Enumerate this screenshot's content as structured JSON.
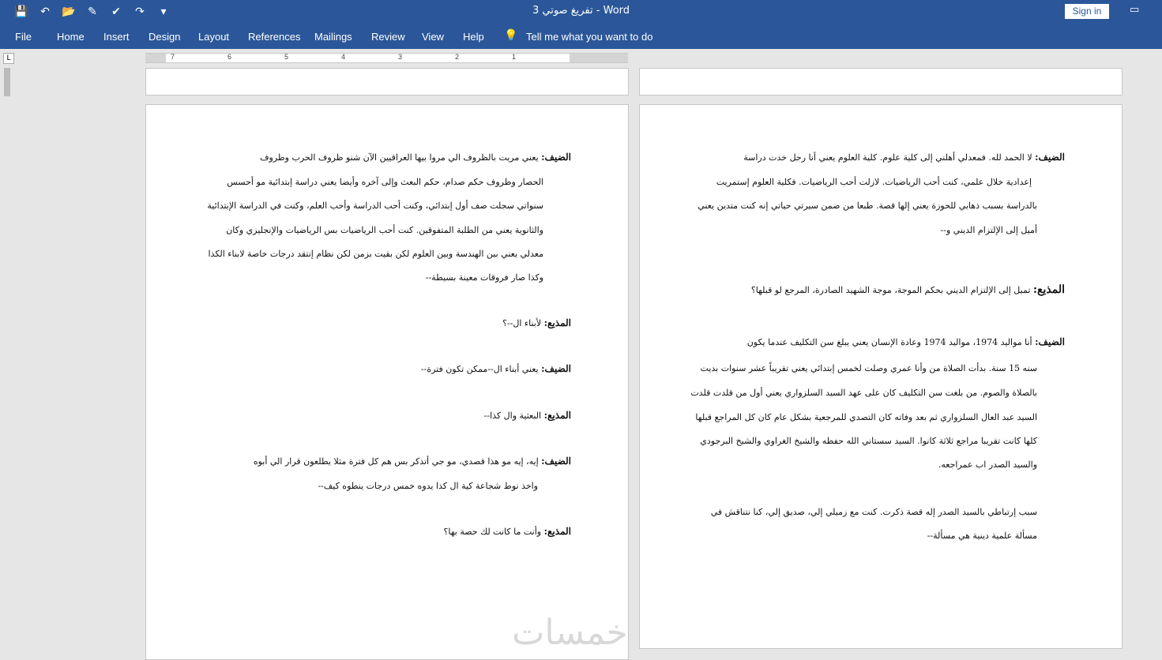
{
  "window": {
    "title": "تفريغ صوتي 3  -  Word",
    "signin": "Sign in"
  },
  "qat_icons": [
    "save-icon",
    "undo-icon",
    "open-icon",
    "format-painter-icon",
    "check-icon",
    "redo-icon",
    "customize-icon"
  ],
  "qat_glyphs": [
    "💾",
    "↶",
    "📂",
    "✎",
    "✔",
    "↷",
    "▾"
  ],
  "ribbon": {
    "tabs": [
      "File",
      "Home",
      "Insert",
      "Design",
      "Layout",
      "References",
      "Mailings",
      "Review",
      "View",
      "Help"
    ],
    "tell_me": "Tell me what you want to do",
    "bulb": "💡"
  },
  "ruler": {
    "numbers": [
      "7",
      "6",
      "5",
      "4",
      "3",
      "2",
      "1"
    ]
  },
  "left_page": {
    "lines": [
      {
        "speaker": "الضيف:",
        "text": "يعني مريت بالظروف الي مروا بيها العراقيين الآن شنو ظروف الحرب وظروف"
      },
      {
        "text": "الحصار وظروف حكم صدام، حكم البعث وإلى آخره وأيضا يعني دراسة إبتدائية مو أحسس"
      },
      {
        "text": "سنواتي سجلت صف أول إبتدائي، وكنت أحب الدراسة وأحب العلم، وكنت في الدراسة الإبتدائية"
      },
      {
        "text": "والثانوية يعني من الطلبة المتفوقين. كنت أحب الرياضيات بس الرياضيات والإنجليزي وكان"
      },
      {
        "text": "معدلي يعني بين الهندسة وبين العلوم لكن بقيت بزمن لكن نظام إنتقد درجات خاصة لابناء الكذا"
      },
      {
        "text": "وكذا صار فروقات معينة بسيطة--"
      },
      {
        "speaker": "المذيع:",
        "text": "لأبناء ال--؟"
      },
      {
        "speaker": "الضيف:",
        "text": "يعني أبناء ال--ممكن تكون فترة--"
      },
      {
        "speaker": "المذيع:",
        "text": "البعثية وال كذا--"
      },
      {
        "speaker": "الضيف:",
        "text": "إيه، إيه مو هذا قصدي، مو جي أتذكر بس هم كل فترة مثلا يطلعون قرار الي أبوه"
      },
      {
        "text": "واخذ نوط شجاعة كية ال كذا يدوه خمس درجات ينطوه كيف--"
      },
      {
        "speaker": "المذيع:",
        "text": "وأنت ما كانت لك حصة بها؟"
      }
    ]
  },
  "right_page": {
    "lines": [
      {
        "speaker": "الضيف:",
        "text": "لا الحمد لله. فمعدلي أهلني إلى كلية علوم. كلية العلوم يعني أنا رجل خدت دراسة"
      },
      {
        "text": "إعدادية خلال علمي، كنت أحب الرياضيات. لازلت أحب الرياضيات. فكلية العلوم إستمريت"
      },
      {
        "text": "بالدراسة بسبب ذهابي للحوزة يعني إلها قصة. طبعا من ضمن سيرتي حياتي إنه كنت متدين يعني"
      },
      {
        "text": "أميل إلى الإلتزام الديني و--"
      },
      {
        "speaker": "المذيع:",
        "text": "تميل إلى الإلتزام الديني بحكم الموجة، موجة الشهيد الصادرة، المرجع لو قبلها؟"
      },
      {
        "speaker": "الضيف:",
        "text": "أنا مواليد 1974، مواليد 1974 وعادة الإنسان يعني يبلغ سن التكليف عندما يكون"
      },
      {
        "text": "سنه 15 سنة. بدأت الصلاة من وأنا عمري وصلت لخمس إبتدائي يعني تقريباً عشر سنوات بديت"
      },
      {
        "text": "بالصلاة والصوم. من بلغت سن التكليف كان على عهد السيد السلزواري يعني أول من قلدت قلدت"
      },
      {
        "text": "السيد عبد العال السلزواري ثم بعد وفاته كان التصدي للمرجعية بشكل عام كان كل المراجع قبلها"
      },
      {
        "text": "كلها كانت تقريبا مراجع ثلاثة كانوا. السيد سستاني الله حفظه والشيخ الغراوي والشيخ البرجودي"
      },
      {
        "text": "والسيد الصدر اب عمراجعه."
      },
      {
        "text": "سبب إرتباطي بالسيد الصدر إله قصة ذكرت. كنت مع زميلي إلي، صديق إلي، كنا نتناقش في"
      },
      {
        "text": "مسألة علمية دينية هي مسألة--"
      }
    ]
  },
  "watermark": "خمسات"
}
